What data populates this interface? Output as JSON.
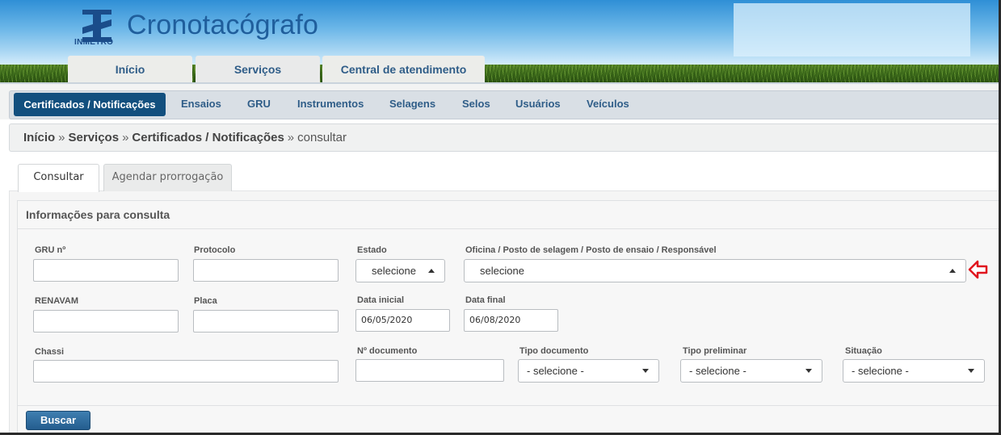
{
  "header": {
    "logo_text": "INMETRO",
    "app_title": "Cronotacógrafo",
    "top_tabs": [
      {
        "label": "Início",
        "active": false
      },
      {
        "label": "Serviços",
        "active": true
      },
      {
        "label": "Central de atendimento",
        "active": false
      }
    ]
  },
  "menu": {
    "items": [
      {
        "label": "Certificados / Notificações",
        "active": true
      },
      {
        "label": "Ensaios"
      },
      {
        "label": "GRU"
      },
      {
        "label": "Instrumentos"
      },
      {
        "label": "Selagens"
      },
      {
        "label": "Selos"
      },
      {
        "label": "Usuários"
      },
      {
        "label": "Veículos"
      }
    ]
  },
  "breadcrumb": {
    "items": [
      "Início",
      "Serviços",
      "Certificados / Notificações"
    ],
    "separator": "»",
    "current": "consultar"
  },
  "tabs": [
    {
      "label": "Consultar",
      "active": true
    },
    {
      "label": "Agendar prorrogação",
      "active": false
    }
  ],
  "form": {
    "section_title": "Informações para consulta",
    "fields": {
      "gru": {
        "label": "GRU nº",
        "value": ""
      },
      "protocolo": {
        "label": "Protocolo",
        "value": ""
      },
      "estado": {
        "label": "Estado",
        "value": "selecione"
      },
      "oficina": {
        "label": "Oficina / Posto de selagem / Posto de ensaio / Responsável",
        "value": "selecione"
      },
      "renavam": {
        "label": "RENAVAM",
        "value": ""
      },
      "placa": {
        "label": "Placa",
        "value": ""
      },
      "data_inicial": {
        "label": "Data inicial",
        "value": "06/05/2020"
      },
      "data_final": {
        "label": "Data final",
        "value": "06/08/2020"
      },
      "chassi": {
        "label": "Chassi",
        "value": ""
      },
      "documento": {
        "label": "Nº documento",
        "value": ""
      },
      "tipo_documento": {
        "label": "Tipo documento",
        "value": "- selecione -"
      },
      "tipo_preliminar": {
        "label": "Tipo preliminar",
        "value": "- selecione -"
      },
      "situacao": {
        "label": "Situação",
        "value": "- selecione -"
      }
    },
    "submit_label": "Buscar"
  },
  "colors": {
    "brand_blue": "#124f7e",
    "link_blue": "#2f5d88",
    "annotation_red": "#e0141e"
  }
}
